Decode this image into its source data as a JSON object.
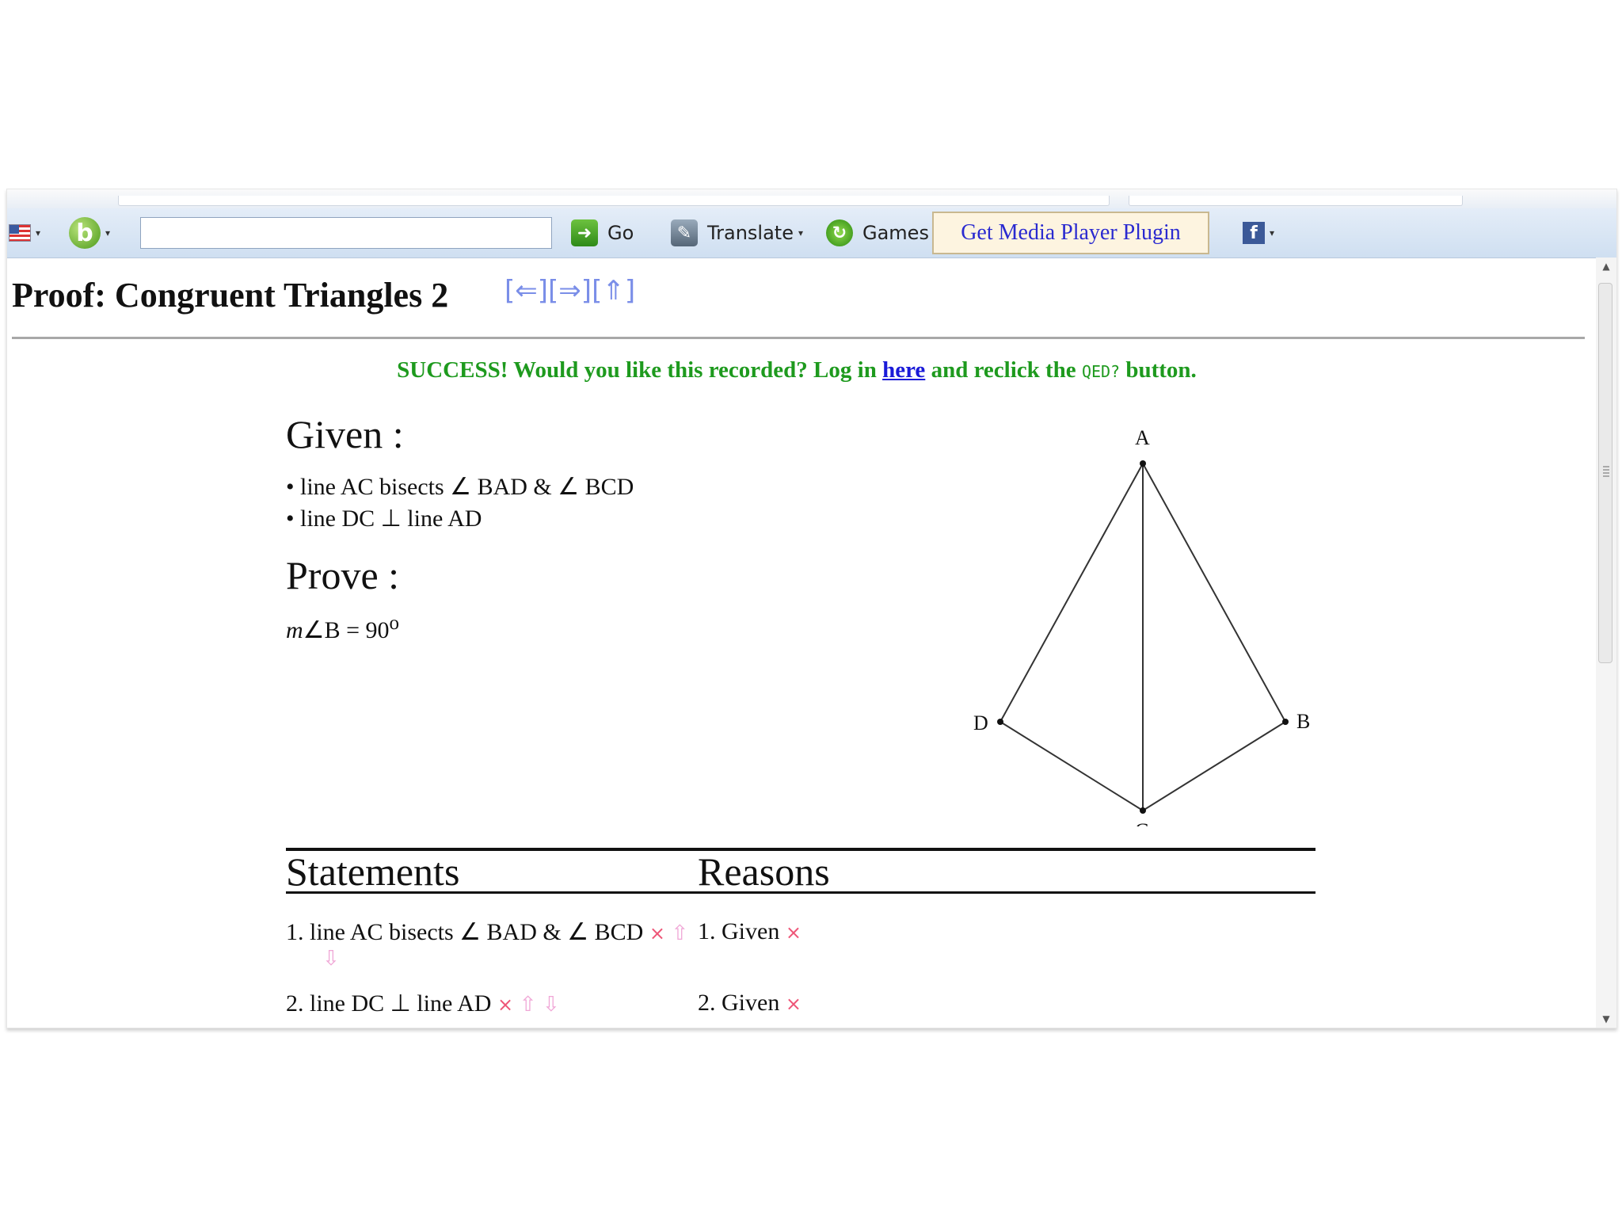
{
  "toolbar": {
    "go_label": "Go",
    "translate_label": "Translate",
    "games_label": "Games",
    "media_button_label": "Get Media Player Plugin",
    "search_value": "",
    "caret": "▾"
  },
  "page": {
    "title": "Proof: Congruent Triangles 2",
    "nav_links": [
      "[⇐]",
      "[⇒]",
      "[⇑]"
    ]
  },
  "success": {
    "prefix": "SUCCESS! Would you like this recorded? Log in ",
    "link_text": "here",
    "middle": " and reclick the ",
    "qed_label": "QED?",
    "suffix": " button."
  },
  "given": {
    "heading": "Given :",
    "items": [
      "line AC bisects ∠ BAD & ∠ BCD",
      "line DC ⊥ line AD"
    ]
  },
  "prove": {
    "heading": "Prove :",
    "statement_prefix": "m",
    "statement_rest": "∠B = 90",
    "degree": "o"
  },
  "diagram": {
    "points": [
      "A",
      "B",
      "C",
      "D"
    ]
  },
  "proof_table": {
    "headers": [
      "Statements",
      "Reasons"
    ],
    "rows": [
      {
        "num": "1.",
        "statement": "line AC bisects ∠ BAD & ∠ BCD",
        "reason": "Given"
      },
      {
        "num": "2.",
        "statement": "line DC ⊥ line AD",
        "reason": "Given"
      }
    ],
    "delete_mark": "×",
    "up_mark": "⇧",
    "down_mark": "⇩"
  }
}
